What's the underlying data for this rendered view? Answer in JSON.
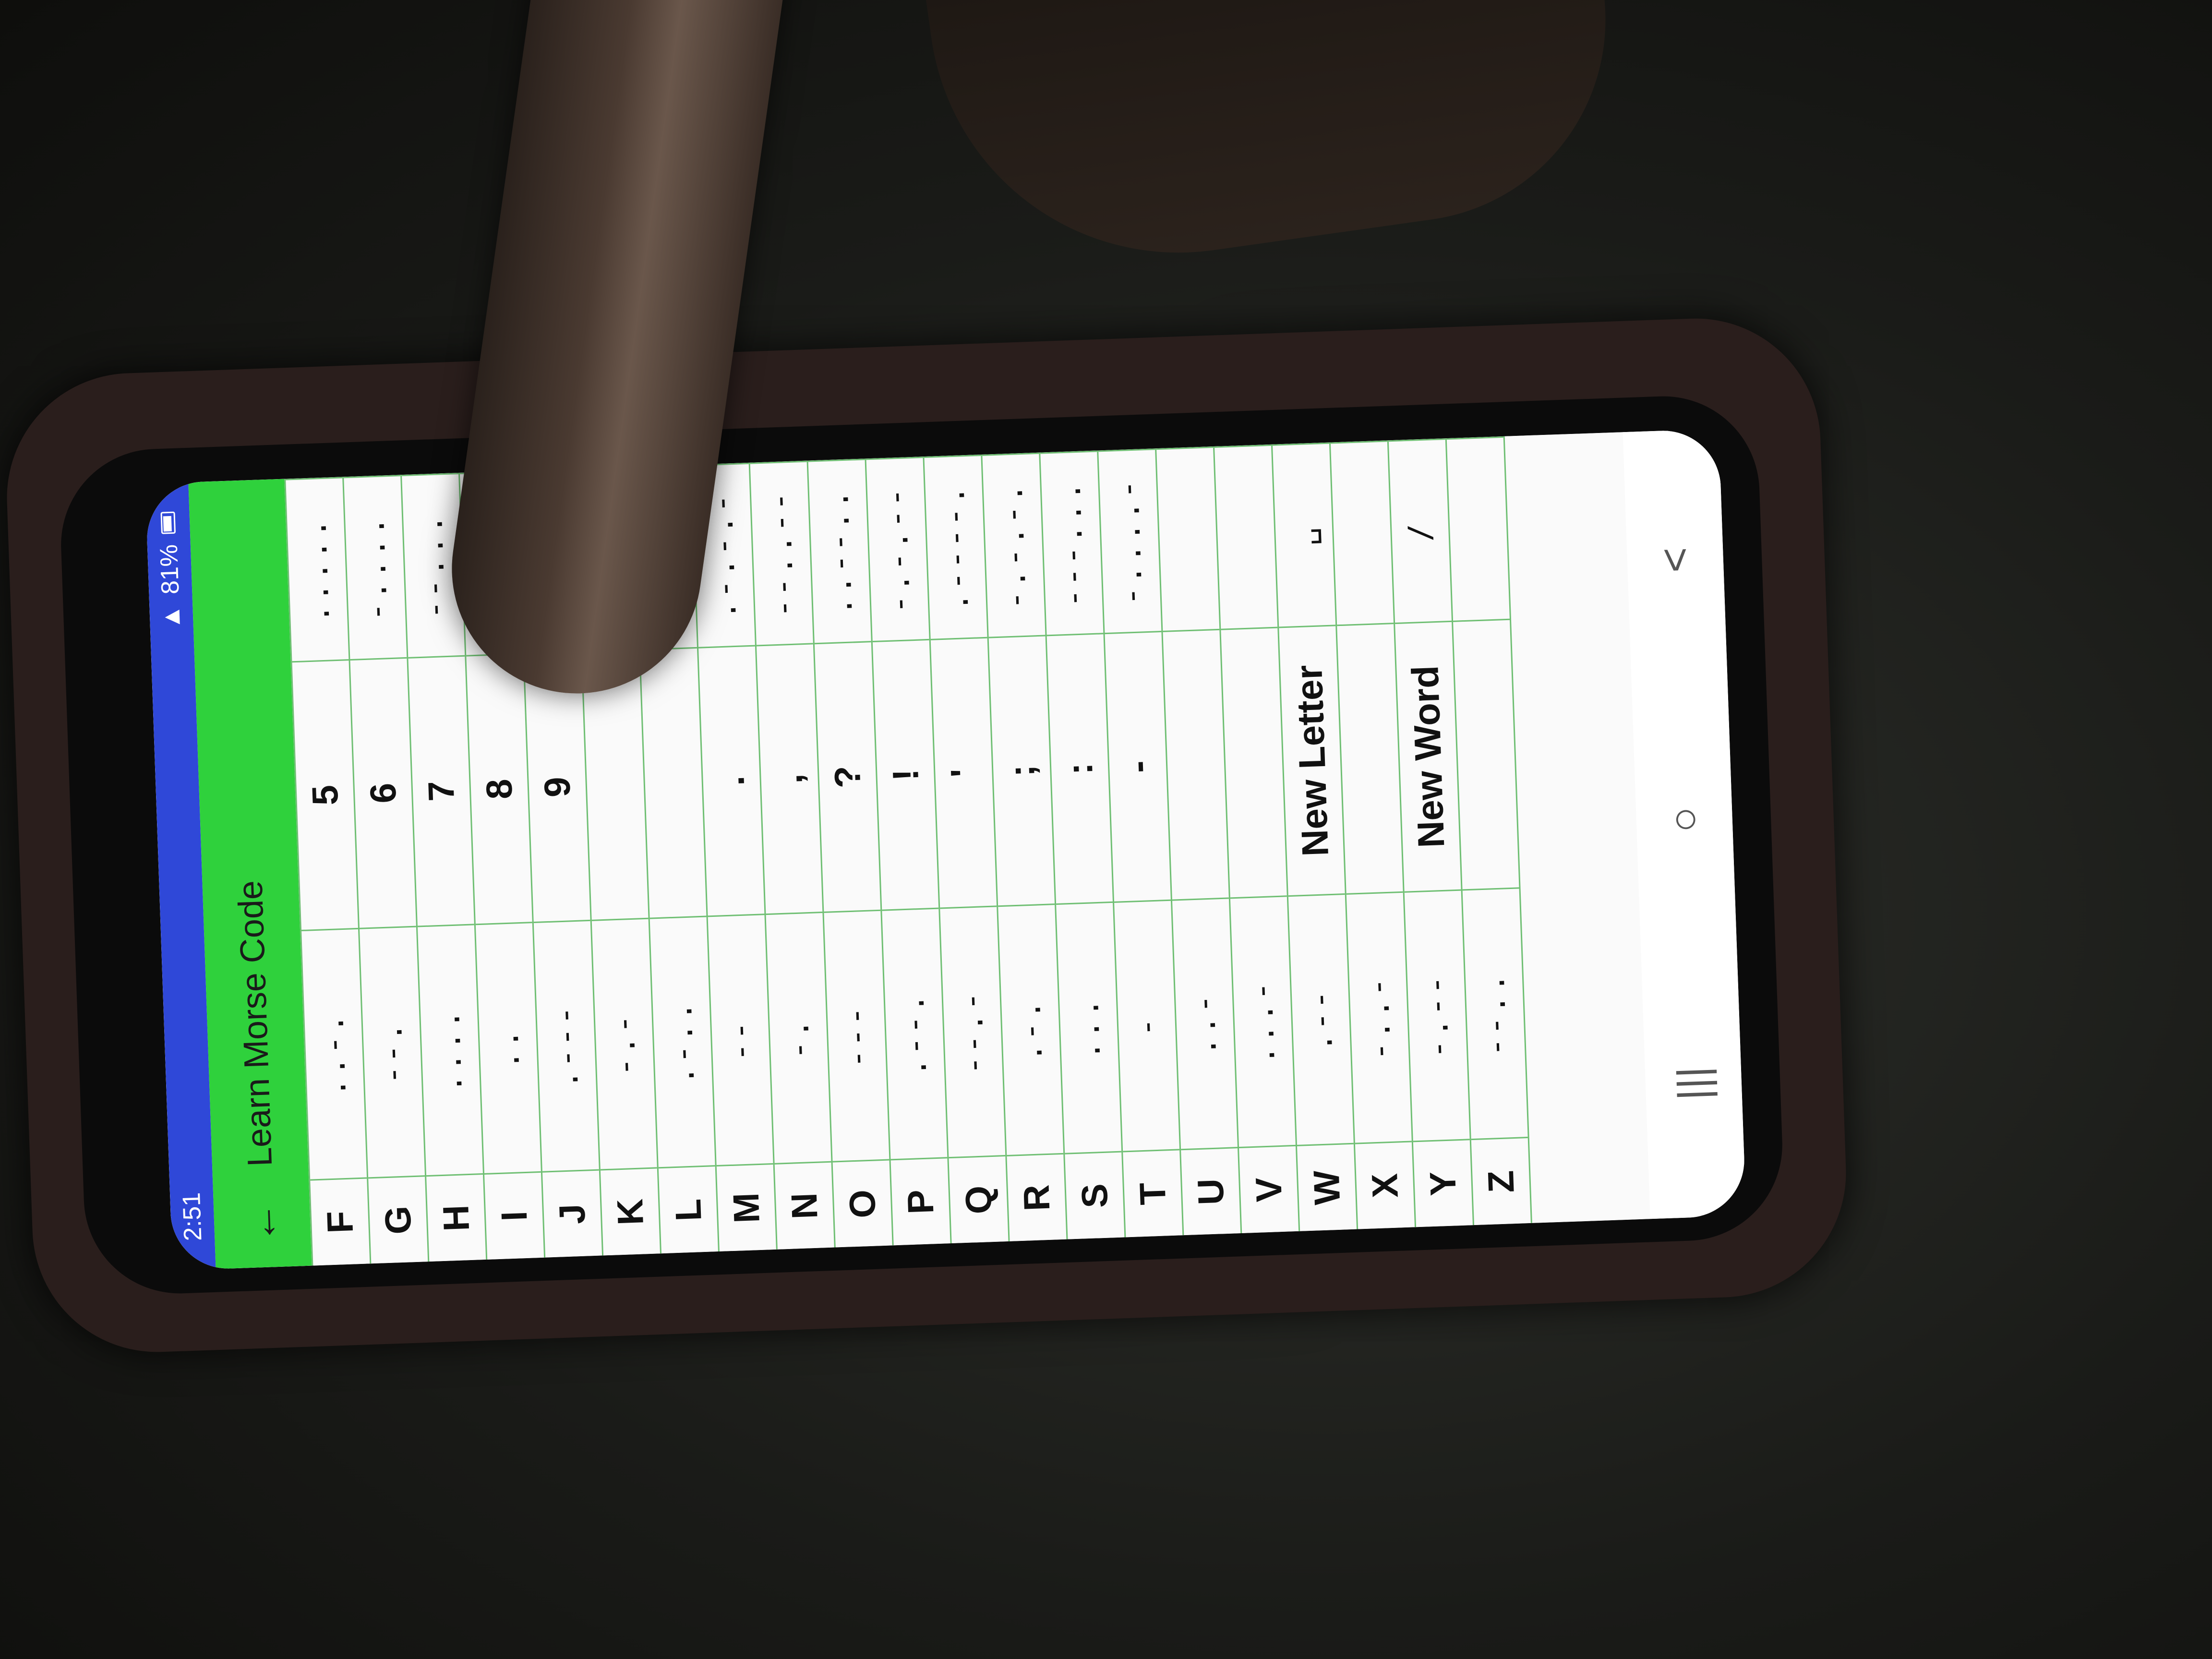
{
  "status_bar": {
    "time": "2:51",
    "battery": "81%"
  },
  "app_bar": {
    "back_icon": "←",
    "title": "Learn Morse Code"
  },
  "table_rows": [
    {
      "letter": "F",
      "letter_code": "..-.",
      "symbol": "5",
      "symbol_code": "....."
    },
    {
      "letter": "G",
      "letter_code": "--.",
      "symbol": "6",
      "symbol_code": "-...."
    },
    {
      "letter": "H",
      "letter_code": "....",
      "symbol": "7",
      "symbol_code": "--..."
    },
    {
      "letter": "I",
      "letter_code": "..",
      "symbol": "8",
      "symbol_code": "---.."
    },
    {
      "letter": "J",
      "letter_code": ".---",
      "symbol": "9",
      "symbol_code": "----."
    },
    {
      "letter": "K",
      "letter_code": "-.-",
      "symbol": "",
      "symbol_code": ""
    },
    {
      "letter": "L",
      "letter_code": ".-..",
      "symbol": "",
      "symbol_code": ""
    },
    {
      "letter": "M",
      "letter_code": "--",
      "symbol": ".",
      "symbol_code": ".-.-.-"
    },
    {
      "letter": "N",
      "letter_code": "-.",
      "symbol": ",",
      "symbol_code": "--..--"
    },
    {
      "letter": "O",
      "letter_code": "---",
      "symbol": "?",
      "symbol_code": "..--.."
    },
    {
      "letter": "P",
      "letter_code": ".--.",
      "symbol": "!",
      "symbol_code": "-.-.--"
    },
    {
      "letter": "Q",
      "letter_code": "--.-",
      "symbol": "'",
      "symbol_code": ".----."
    },
    {
      "letter": "R",
      "letter_code": ".-.",
      "symbol": ";",
      "symbol_code": "-.-.-."
    },
    {
      "letter": "S",
      "letter_code": "...",
      "symbol": ":",
      "symbol_code": "---..."
    },
    {
      "letter": "T",
      "letter_code": "-",
      "symbol": "-",
      "symbol_code": "-....-"
    },
    {
      "letter": "U",
      "letter_code": "..-",
      "symbol": "",
      "symbol_code": ""
    },
    {
      "letter": "V",
      "letter_code": "...-",
      "symbol": "",
      "symbol_code": ""
    },
    {
      "letter": "W",
      "letter_code": ".--",
      "symbol": "New Letter",
      "symbol_code": "␣"
    },
    {
      "letter": "X",
      "letter_code": "-..-",
      "symbol": "",
      "symbol_code": ""
    },
    {
      "letter": "Y",
      "letter_code": "-.--",
      "symbol": "New Word",
      "symbol_code": "/"
    },
    {
      "letter": "Z",
      "letter_code": "--..",
      "symbol": "",
      "symbol_code": ""
    }
  ],
  "nav_bar": {
    "recents_icon": "|||",
    "home_icon": "○",
    "back_icon": "<"
  }
}
